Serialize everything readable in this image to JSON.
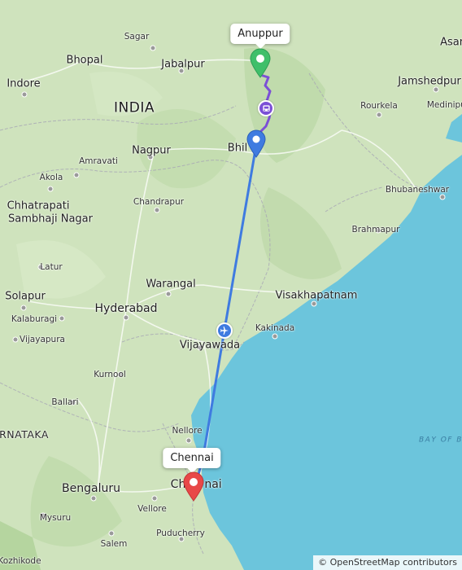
{
  "map": {
    "country_label": "INDIA",
    "state_label": "ARNATAKA",
    "sea_label": "BAY OF B",
    "cities": {
      "bhopal": "Bhopal",
      "jabalpur": "Jabalpur",
      "sagar": "Sagar",
      "indore": "Indore",
      "nagpur": "Nagpur",
      "amravati": "Amravati",
      "akola": "Akola",
      "sambhaji_l1": "Chhatrapati",
      "sambhaji_l2": "Sambhaji Nagar",
      "chandrapur": "Chandrapur",
      "latur": "Latur",
      "solapur": "Solapur",
      "kalaburagi": "Kalaburagi",
      "vijayapura": "Vijayapura",
      "hyderabad": "Hyderabad",
      "warangal": "Warangal",
      "kurnool": "Kurnool",
      "ballari": "Ballari",
      "nellore": "Nellore",
      "bengaluru": "Bengaluru",
      "mysuru": "Mysuru",
      "vellore": "Vellore",
      "salem": "Salem",
      "puducherry": "Puducherry",
      "kozhikode": "Kozhikode",
      "vijayawada": "Vijayawada",
      "kakinada": "Kakinada",
      "visakhapatnam": "Visakhapatnam",
      "brahmapur": "Brahmapur",
      "bhubaneshwar": "Bhubaneshwar",
      "rourkela": "Rourkela",
      "jamshedpur": "Jamshedpur",
      "medinipur": "Medinipur",
      "asansol": "Asan",
      "bhilai_partial": "Bhil",
      "chennai_partial": "Ch",
      "chennai_tail": "nai"
    },
    "route": {
      "origin_label": "Anuppur",
      "destination_label": "Chennai",
      "bus_color": "#7b4fd6",
      "flight_color": "#3f7be0",
      "origin_pin_color": "#3fbf6a",
      "destination_pin_color": "#e84848",
      "transfer_pin_color": "#3f7be0",
      "bus_icon": "bus-icon",
      "flight_icon": "airplane-icon"
    },
    "attribution": "© OpenStreetMap contributors"
  }
}
